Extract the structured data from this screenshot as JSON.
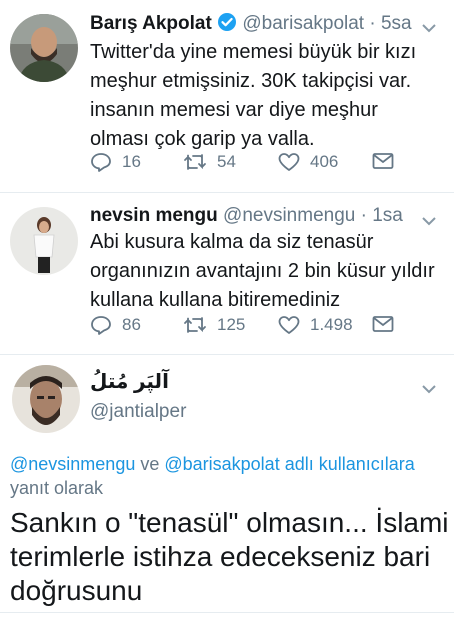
{
  "tweets": [
    {
      "name": "Barış Akpolat",
      "handle": "@barisakpolat",
      "sep": "·",
      "time": "5sa",
      "verified": true,
      "text": "Twitter'da yine memesi büyük bir kızı meşhur etmişsiniz. 30K takipçisi var. insanın memesi var diye meşhur olması çok garip ya valla.",
      "replies": "16",
      "retweets": "54",
      "likes": "406"
    },
    {
      "name": "nevsin mengu",
      "handle": "@nevsinmengu",
      "sep": "·",
      "time": "1sa",
      "verified": false,
      "text": "Abi kusura kalma da siz tenasür organınızın avantajını 2 bin küsur yıldır kullana kullana bitiremediniz",
      "replies": "86",
      "retweets": "125",
      "likes": "1.498"
    }
  ],
  "focused": {
    "name": "آلپَر مُتلُ",
    "handle": "@jantialper",
    "reply_mention_1": "@nevsinmengu",
    "reply_joiner": " ve ",
    "reply_mention_2": "@barisakpolat",
    "reply_suffix": " adlı kullanıcılara",
    "reply_line2": "yanıt olarak",
    "text": "Sankın o \"tenasül\" olmasın... İslami terimlerle istihza edecekseniz bari doğrusunu"
  },
  "colors": {
    "verified": "#1da1f2",
    "muted": "#657786",
    "link": "#1b95e0",
    "text": "#14171a"
  },
  "icons": [
    "reply-icon",
    "retweet-icon",
    "like-icon",
    "message-icon",
    "verified-icon",
    "chevron-down-icon"
  ]
}
